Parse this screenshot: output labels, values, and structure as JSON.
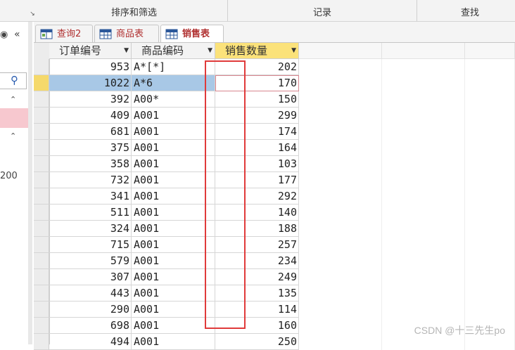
{
  "ribbon": {
    "groups": [
      {
        "label": "排序和筛选"
      },
      {
        "label": "记录"
      },
      {
        "label": "查找"
      }
    ]
  },
  "nav": {
    "number": "200"
  },
  "tabs": [
    {
      "label": "查询2",
      "icon": "query-icon",
      "active": false
    },
    {
      "label": "商品表",
      "icon": "table-icon",
      "active": false
    },
    {
      "label": "销售表",
      "icon": "table-icon",
      "active": true
    }
  ],
  "grid": {
    "columns": [
      "订单编号",
      "商品编码",
      "销售数量"
    ],
    "sorted_column_color": "#fbe27a",
    "current_row_color": "#a8c8e6",
    "rows": [
      [
        "953",
        "A*[*]",
        "202"
      ],
      [
        "1022",
        "A*6",
        "170"
      ],
      [
        "392",
        "A00*",
        "150"
      ],
      [
        "409",
        "A001",
        "299"
      ],
      [
        "681",
        "A001",
        "174"
      ],
      [
        "375",
        "A001",
        "164"
      ],
      [
        "358",
        "A001",
        "103"
      ],
      [
        "732",
        "A001",
        "177"
      ],
      [
        "341",
        "A001",
        "292"
      ],
      [
        "511",
        "A001",
        "140"
      ],
      [
        "324",
        "A001",
        "188"
      ],
      [
        "715",
        "A001",
        "257"
      ],
      [
        "579",
        "A001",
        "234"
      ],
      [
        "307",
        "A001",
        "249"
      ],
      [
        "443",
        "A001",
        "135"
      ],
      [
        "290",
        "A001",
        "114"
      ],
      [
        "698",
        "A001",
        "160"
      ],
      [
        "494",
        "A001",
        "250"
      ]
    ],
    "current_row": 1
  },
  "annotation_color": "#e03a3a",
  "watermark": "CSDN @十三先生po"
}
